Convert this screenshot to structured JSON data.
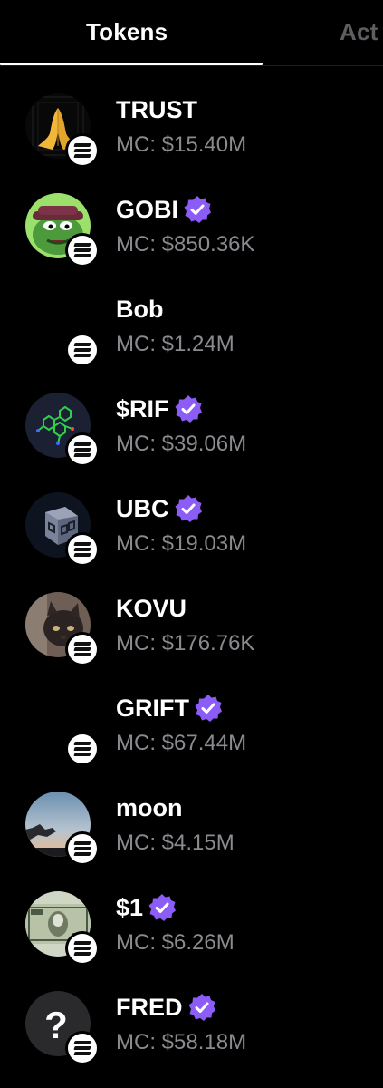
{
  "tabs": [
    {
      "label": "Tokens",
      "active": true
    },
    {
      "label": "Act",
      "active": false
    }
  ],
  "mc_prefix": "MC:",
  "colors": {
    "background": "#000000",
    "verified": "#8b5cf6",
    "muted_text": "#8a8a8f"
  },
  "tokens": [
    {
      "name": "TRUST",
      "mc": "MC: $15.40M",
      "verified": false,
      "avatar": "praying-hands-icon"
    },
    {
      "name": "GOBI",
      "mc": "MC: $850.36K",
      "verified": true,
      "avatar": "frog-character-icon"
    },
    {
      "name": "Bob",
      "mc": "MC: $1.24M",
      "verified": false,
      "avatar": "none"
    },
    {
      "name": "$RIF",
      "mc": "MC: $39.06M",
      "verified": true,
      "avatar": "molecule-icon"
    },
    {
      "name": "UBC",
      "mc": "MC: $19.03M",
      "verified": true,
      "avatar": "cube-icon"
    },
    {
      "name": "KOVU",
      "mc": "MC: $176.76K",
      "verified": false,
      "avatar": "cat-photo"
    },
    {
      "name": "GRIFT",
      "mc": "MC: $67.44M",
      "verified": true,
      "avatar": "none"
    },
    {
      "name": "moon",
      "mc": "MC: $4.15M",
      "verified": false,
      "avatar": "sky-hand-photo"
    },
    {
      "name": "$1",
      "mc": "MC: $6.26M",
      "verified": true,
      "avatar": "dollar-bill-photo"
    },
    {
      "name": "FRED",
      "mc": "MC: $58.18M",
      "verified": true,
      "avatar": "question-mark-icon"
    }
  ]
}
